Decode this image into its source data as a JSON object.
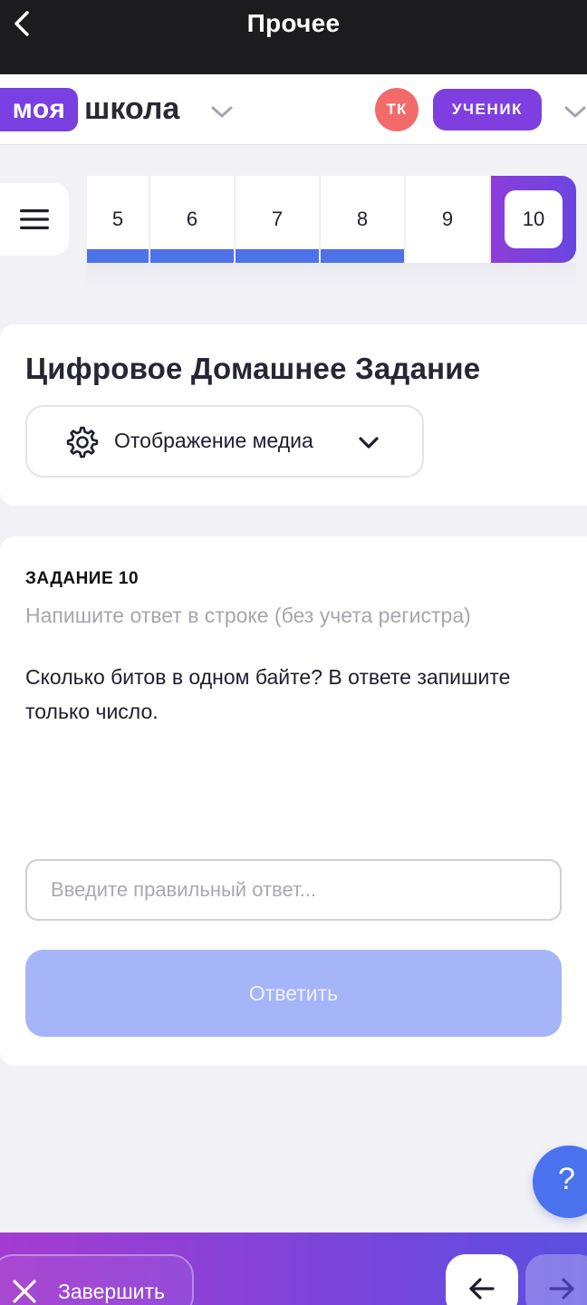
{
  "topbar": {
    "title": "Прочее",
    "back_icon": "chevron-left-icon"
  },
  "header": {
    "logo_part1": "моя",
    "logo_part2": "школа",
    "avatar_initials": "ТК",
    "role": "УЧЕНИК",
    "colors": {
      "brand": "#7a3fe0",
      "avatar": "#f26a6a"
    }
  },
  "task_nav": {
    "tasks": [
      {
        "label": "5",
        "done": true
      },
      {
        "label": "6",
        "done": true
      },
      {
        "label": "7",
        "done": true
      },
      {
        "label": "8",
        "done": true
      },
      {
        "label": "9",
        "done": false
      },
      {
        "label": "10",
        "done": false,
        "active": true
      }
    ],
    "done_color": "#4d72ea"
  },
  "page": {
    "title": "Цифровое Домашнее Задание",
    "media_dropdown": "Отображение медиа"
  },
  "task": {
    "number": "ЗАДАНИЕ 10",
    "instruction": "Напишите ответ в строке (без учета регистра)",
    "question": "Сколько битов в одном байте? В ответе запишите только число.",
    "answer_value": "",
    "answer_placeholder": "Введите правильный ответ...",
    "submit_label": "Ответить"
  },
  "help": {
    "label": "?"
  },
  "bottombar": {
    "finish_label": "Завершить"
  }
}
